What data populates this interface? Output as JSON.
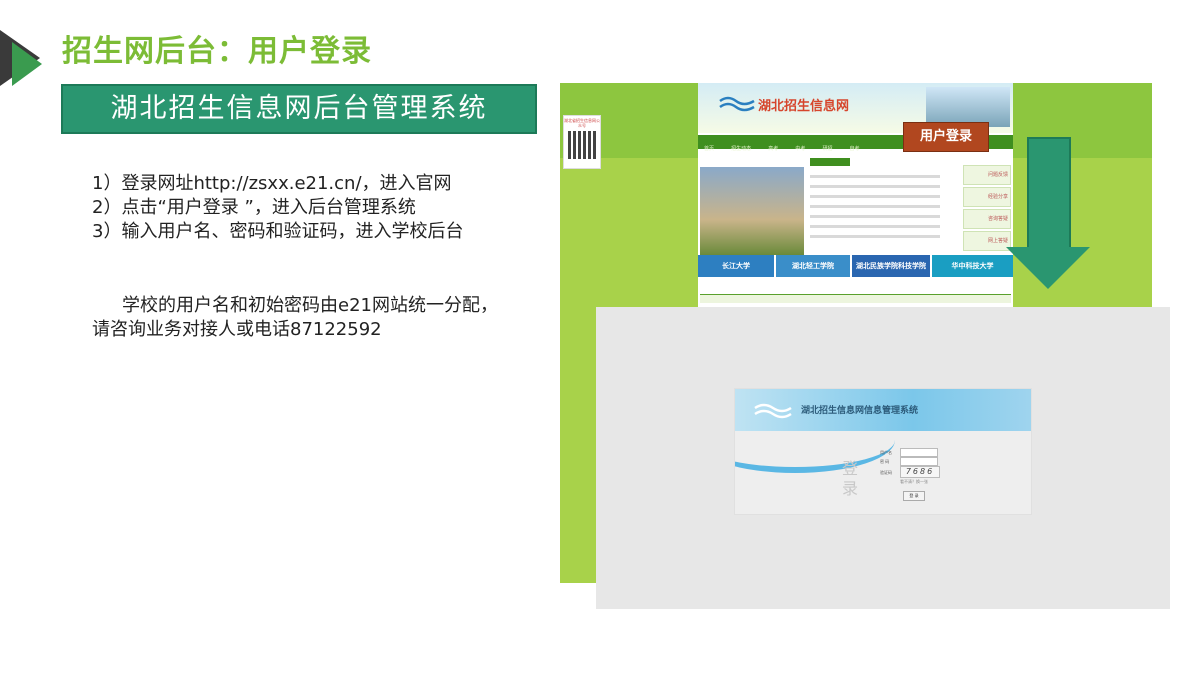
{
  "slide": {
    "title": "招生网后台：用户登录",
    "banner": "湖北招生信息网后台管理系统",
    "steps": [
      "1）登录网址http://zsxx.e21.cn/，进入官网",
      "2）点击“用户登录 ”，进入后台管理系统",
      "3）输入用户名、密码和验证码，进入学校后台"
    ],
    "note_line1": "学校的用户名和初始密码由e21网站统一分配，",
    "note_line2": "请咨询业务对接人或电话87122592"
  },
  "site": {
    "logo": "湖北招生信息网",
    "login_button": "用户登录",
    "nav": [
      "首页",
      "招生动态",
      "高考",
      "中考",
      "研招",
      "自考"
    ],
    "partners": [
      "长江大学",
      "湖北轻工学院",
      "湖北民族学院科技学院",
      "华中科技大学"
    ],
    "sidebar": [
      "问题反馈",
      "经验分享",
      "咨询答疑",
      "网上答疑"
    ],
    "qr_caption": "湖北省招生信息网公众号"
  },
  "backend": {
    "title": "湖北招生信息网信息管理系统",
    "side_text": "登录",
    "fields": [
      "用户名",
      "密 码",
      "验证码"
    ],
    "captcha": "7686",
    "captcha_tip": "看不清？换一张",
    "submit": "登 录"
  },
  "colors": {
    "title_green": "#7cbc36",
    "banner_teal": "#2a9670",
    "login_red": "#b1471f"
  }
}
